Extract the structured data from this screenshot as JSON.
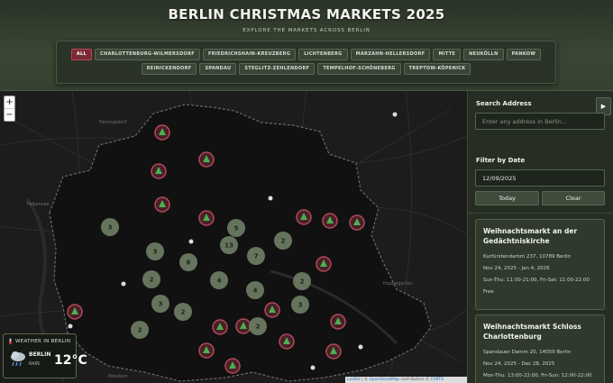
{
  "header": {
    "title": "BERLIN CHRISTMAS MARKETS 2025",
    "subtitle": "EXPLORE THE MARKETS ACROSS BERLIN"
  },
  "districts": {
    "row1": [
      "ALL",
      "CHARLOTTENBURG-WILMERSDORF",
      "FRIEDRICHSHAIN-KREUZBERG",
      "LICHTENBERG",
      "MARZAHN-HELLERSDORF",
      "MITTE",
      "NEUKÖLLN",
      "PANKOW"
    ],
    "row2": [
      "REINICKENDORF",
      "SPANDAU",
      "STEGLITZ-ZEHLENDORF",
      "TEMPELHOF-SCHÖNEBERG",
      "TREPTOW-KÖPENICK"
    ],
    "active": "ALL"
  },
  "map": {
    "zoom_in": "+",
    "zoom_out": "−",
    "clusters": [
      "3",
      "5",
      "13",
      "2",
      "3",
      "7",
      "6",
      "2",
      "4",
      "2",
      "4",
      "3",
      "3",
      "2",
      "2",
      "2"
    ],
    "attribution": {
      "leaflet": "Leaflet",
      "osm": "OpenStreetMap",
      "contributors": "contributors ©",
      "carto": "CARTO"
    },
    "place_labels": [
      "Hennigsdorf",
      "Falkensee",
      "Potsdam",
      "Hoppegarten"
    ]
  },
  "weather": {
    "heading": "WEATHER IN BERLIN",
    "city": "BERLIN",
    "condition": "RAIN",
    "temperature": "12°C"
  },
  "sidebar": {
    "collapse_icon": "▶",
    "search_label": "Search Address",
    "search_placeholder": "Enter any address in Berlin...",
    "date_label": "Filter by Date",
    "date_value": "12/09/2025",
    "today_button": "Today",
    "clear_button": "Clear"
  },
  "markets": [
    {
      "name": "Weihnachtsmarkt an der Gedächtniskirche",
      "address": "Kurfürstendamm 237, 10789 Berlin",
      "dates": "Nov 24, 2025 - Jan 4, 2026",
      "hours": "Sun-Thu: 11:00-21:00, Fri-Sat: 11:00-22:00",
      "price": "Free"
    },
    {
      "name": "Weihnachtsmarkt Schloss Charlottenburg",
      "address": "Spandauer Damm 20, 14059 Berlin",
      "dates": "Nov 24, 2025 - Dec 28, 2025",
      "hours": "Mon-Thu: 13:00-22:00, Fri-Sun: 12:00-22:00",
      "price": ""
    }
  ],
  "colors": {
    "accent_red": "#b24a58",
    "cluster_green": "#6b7a62",
    "marker_fill": "#4a1f28",
    "tree_green": "#4caf50"
  }
}
